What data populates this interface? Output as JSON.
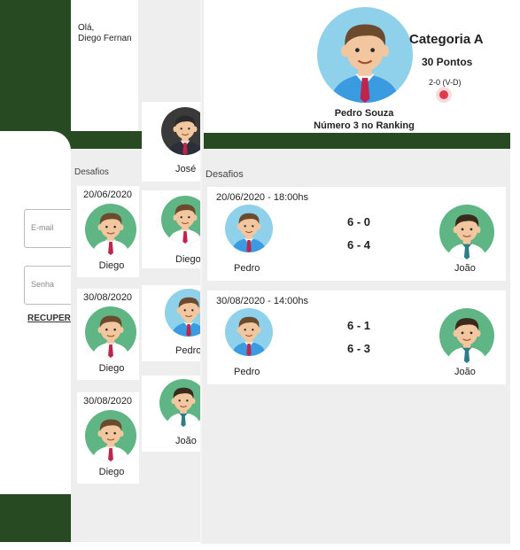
{
  "login": {
    "email_placeholder": "E-mail",
    "password_placeholder": "Senha",
    "recover_label": "RECUPER"
  },
  "greeting": {
    "line1": "Olá,",
    "line2": "Diego Fernan"
  },
  "challenges_list": {
    "title": "Desafios",
    "items": [
      {
        "date": "20/06/2020",
        "name": "Diego",
        "avatar": "boy-avatar-icon"
      },
      {
        "date": "30/08/2020",
        "name": "Diego",
        "avatar": "boy-avatar-icon"
      },
      {
        "date": "30/08/2020",
        "name": "Diego",
        "avatar": "boy-avatar-icon"
      }
    ]
  },
  "ranking_list": {
    "items": [
      {
        "name": "José",
        "avatar": "businessman-avatar-icon"
      },
      {
        "name": "Diego",
        "avatar": "boy-avatar-icon"
      },
      {
        "name": "Pedro",
        "avatar": "man-avatar-icon"
      },
      {
        "name": "João",
        "avatar": "boy-avatar-icon"
      }
    ]
  },
  "profile": {
    "name": "Pedro Souza",
    "ranking": "Número 3 no Ranking",
    "category": "Categoria A",
    "points": "30 Pontos",
    "record": "2-0 (V-D)",
    "avatar": "man-avatar-icon",
    "colors": {
      "brand_green": "#284a22",
      "record_dot": "#e23a4a"
    }
  },
  "matches": {
    "title": "Desafios",
    "items": [
      {
        "datetime": "20/06/2020 - 18:00hs",
        "player_left": "Pedro",
        "player_right": "João",
        "set1": "6 - 0",
        "set2": "6 - 4"
      },
      {
        "datetime": "30/08/2020 - 14:00hs",
        "player_left": "Pedro",
        "player_right": "João",
        "set1": "6 - 1",
        "set2": "6 - 3"
      }
    ]
  }
}
